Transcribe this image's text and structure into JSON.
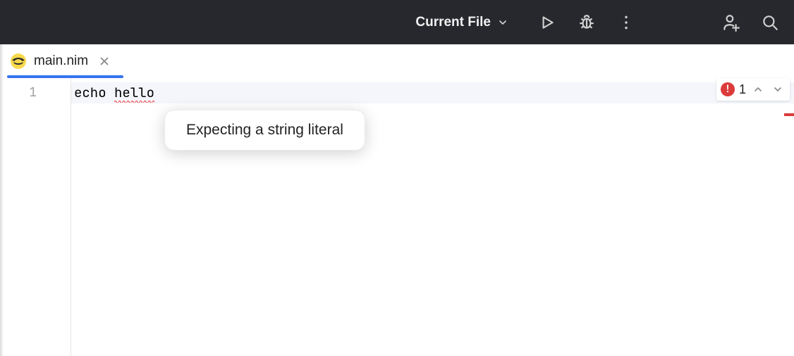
{
  "toolbar": {
    "run_config": "Current File"
  },
  "tab": {
    "filename": "main.nim"
  },
  "editor": {
    "line_number": "1",
    "code_prefix": "echo ",
    "code_error_token": "hello"
  },
  "tooltip": {
    "message": "Expecting a string literal"
  },
  "inspection": {
    "error_glyph": "!",
    "error_count": "1"
  }
}
